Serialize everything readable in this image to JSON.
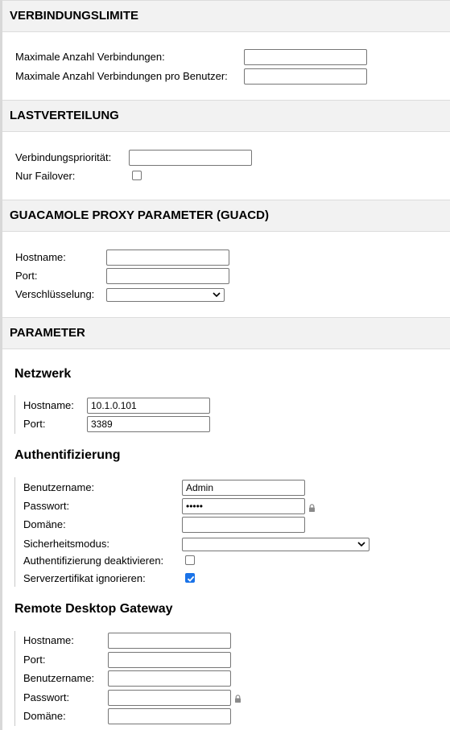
{
  "sections": {
    "connection_limits": {
      "title": "VERBINDUNGSLIMITE",
      "max_connections_label": "Maximale Anzahl Verbindungen:",
      "max_connections_value": "",
      "max_connections_per_user_label": "Maximale Anzahl Verbindungen pro Benutzer:",
      "max_connections_per_user_value": ""
    },
    "load_balancing": {
      "title": "LASTVERTEILUNG",
      "priority_label": "Verbindungspriorität:",
      "priority_value": "",
      "failover_label": "Nur Failover:",
      "failover_checked": false
    },
    "guacd": {
      "title": "GUACAMOLE PROXY PARAMETER (GUACD)",
      "hostname_label": "Hostname:",
      "hostname_value": "",
      "port_label": "Port:",
      "port_value": "",
      "encryption_label": "Verschlüsselung:",
      "encryption_value": ""
    },
    "parameters": {
      "title": "PARAMETER",
      "network": {
        "title": "Netzwerk",
        "hostname_label": "Hostname:",
        "hostname_value": "10.1.0.101",
        "port_label": "Port:",
        "port_value": "3389"
      },
      "auth": {
        "title": "Authentifizierung",
        "username_label": "Benutzername:",
        "username_value": "Admin",
        "password_label": "Passwort:",
        "password_value": "•••••",
        "domain_label": "Domäne:",
        "domain_value": "",
        "security_mode_label": "Sicherheitsmodus:",
        "security_mode_value": "",
        "disable_auth_label": "Authentifizierung deaktivieren:",
        "disable_auth_checked": false,
        "ignore_cert_label": "Serverzertifikat ignorieren:",
        "ignore_cert_checked": true
      },
      "gateway": {
        "title": "Remote Desktop Gateway",
        "hostname_label": "Hostname:",
        "hostname_value": "",
        "port_label": "Port:",
        "port_value": "",
        "username_label": "Benutzername:",
        "username_value": "",
        "password_label": "Passwort:",
        "password_value": "",
        "domain_label": "Domäne:",
        "domain_value": ""
      }
    }
  },
  "icons": {
    "lock": "lock-icon",
    "chevron": "chevron-down-icon",
    "check": "checkmark-icon"
  },
  "colors": {
    "accent": "#1a73e8",
    "header_bg": "#f2f2f2"
  }
}
